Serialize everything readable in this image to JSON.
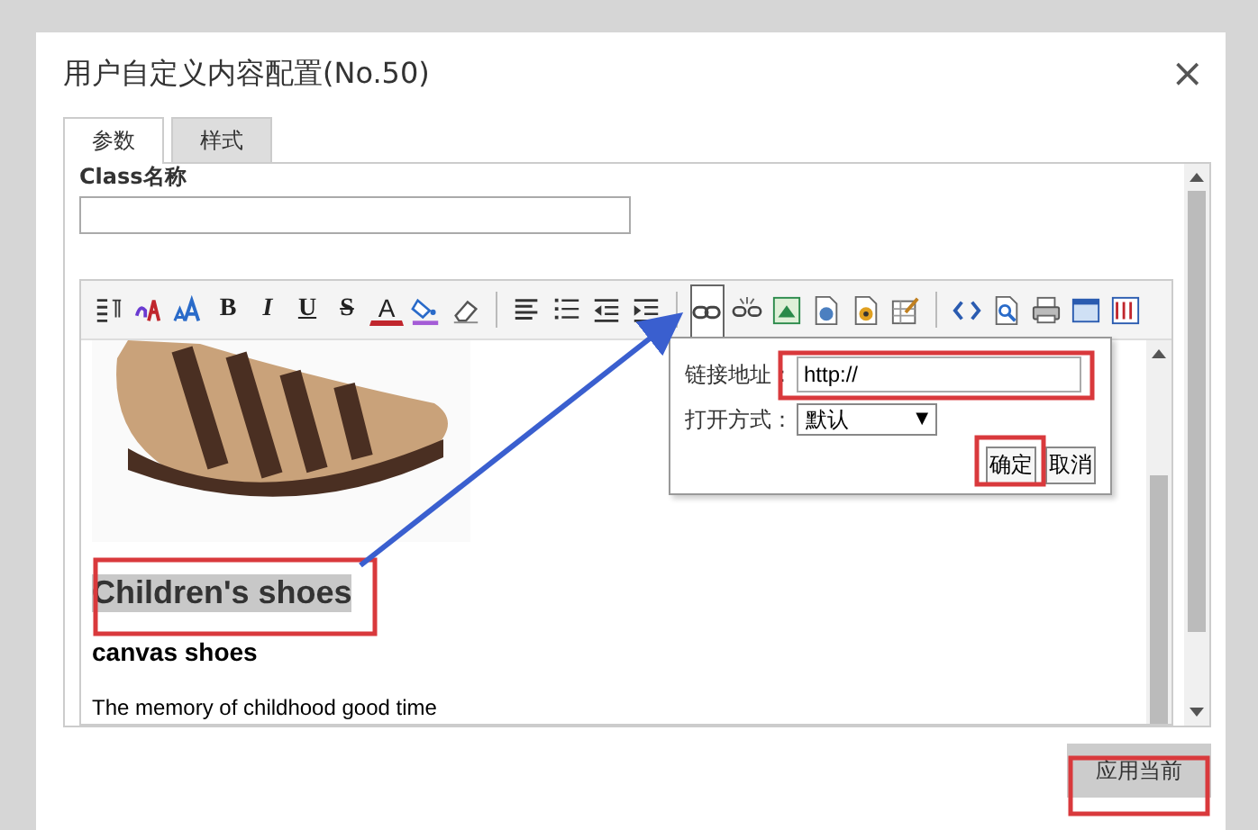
{
  "dialog": {
    "title": "用户自定义内容配置(No.50)",
    "close": "×"
  },
  "tabs": [
    {
      "label": "参数",
      "selected": true
    },
    {
      "label": "样式",
      "selected": false
    }
  ],
  "form": {
    "class_label": "Class名称"
  },
  "toolbar": [
    {
      "kind": "icon",
      "pressed": false
    },
    {
      "kind": "icon",
      "pressed": false
    },
    {
      "kind": "icon",
      "pressed": false
    },
    {
      "kind": "bold",
      "text": "B",
      "pressed": false
    },
    {
      "kind": "italic",
      "text": "I",
      "pressed": false
    },
    {
      "kind": "underline",
      "text": "U",
      "pressed": false
    },
    {
      "kind": "strike",
      "text": "S",
      "pressed": false
    },
    {
      "kind": "color",
      "text": "A",
      "pressed": false
    },
    {
      "kind": "icon",
      "pressed": false
    },
    {
      "kind": "icon",
      "pressed": false
    },
    {
      "kind": "separator"
    },
    {
      "kind": "icon",
      "pressed": false
    },
    {
      "kind": "icon",
      "pressed": false
    },
    {
      "kind": "icon",
      "pressed": false
    },
    {
      "kind": "icon",
      "pressed": false
    },
    {
      "kind": "separator"
    },
    {
      "kind": "icon",
      "pressed": true
    },
    {
      "kind": "icon",
      "pressed": false
    },
    {
      "kind": "icon",
      "pressed": false
    },
    {
      "kind": "icon",
      "pressed": false
    },
    {
      "kind": "icon",
      "pressed": false
    },
    {
      "kind": "icon",
      "pressed": false
    },
    {
      "kind": "separator"
    },
    {
      "kind": "icon",
      "pressed": false
    },
    {
      "kind": "icon",
      "pressed": false
    },
    {
      "kind": "icon",
      "pressed": false
    },
    {
      "kind": "icon",
      "pressed": false
    },
    {
      "kind": "icon",
      "pressed": false
    }
  ],
  "content": [
    {
      "kind": "heading",
      "text": "Children's shoes",
      "selected": true
    },
    {
      "kind": "subheading",
      "text": "canvas shoes",
      "selected": false
    },
    {
      "kind": "paragraph",
      "text": "The memory of childhood good time",
      "selected": false
    }
  ],
  "link_popup": {
    "url_label": "链接地址：",
    "url_value": "http://",
    "target_label": "打开方式：",
    "target_value": "默认",
    "target_caret": "▼",
    "ok": "确定",
    "cancel": "取消"
  },
  "footer": {
    "apply": "应用当前"
  }
}
